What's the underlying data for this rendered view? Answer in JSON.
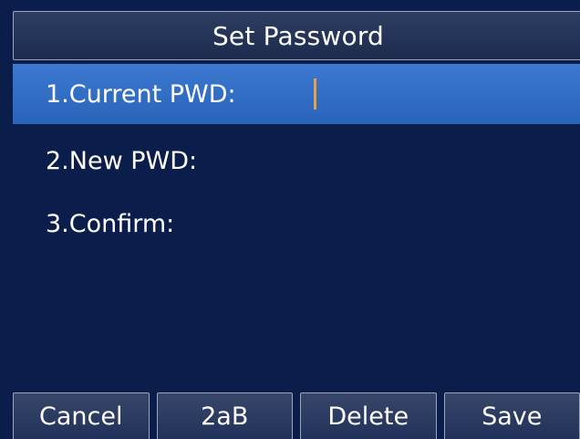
{
  "screen": {
    "title": "Set Password"
  },
  "fields": [
    {
      "label": "1.Current PWD:",
      "value": "",
      "selected": true
    },
    {
      "label": "2.New PWD:",
      "value": "",
      "selected": false
    },
    {
      "label": "3.Confirm:",
      "value": "",
      "selected": false
    }
  ],
  "softkeys": [
    {
      "label": "Cancel"
    },
    {
      "label": "2aB"
    },
    {
      "label": "Delete"
    },
    {
      "label": "Save"
    }
  ],
  "colors": {
    "background": "#0b1d4b",
    "selected_row": "#2f6cc4",
    "cursor": "#e7a04a"
  }
}
